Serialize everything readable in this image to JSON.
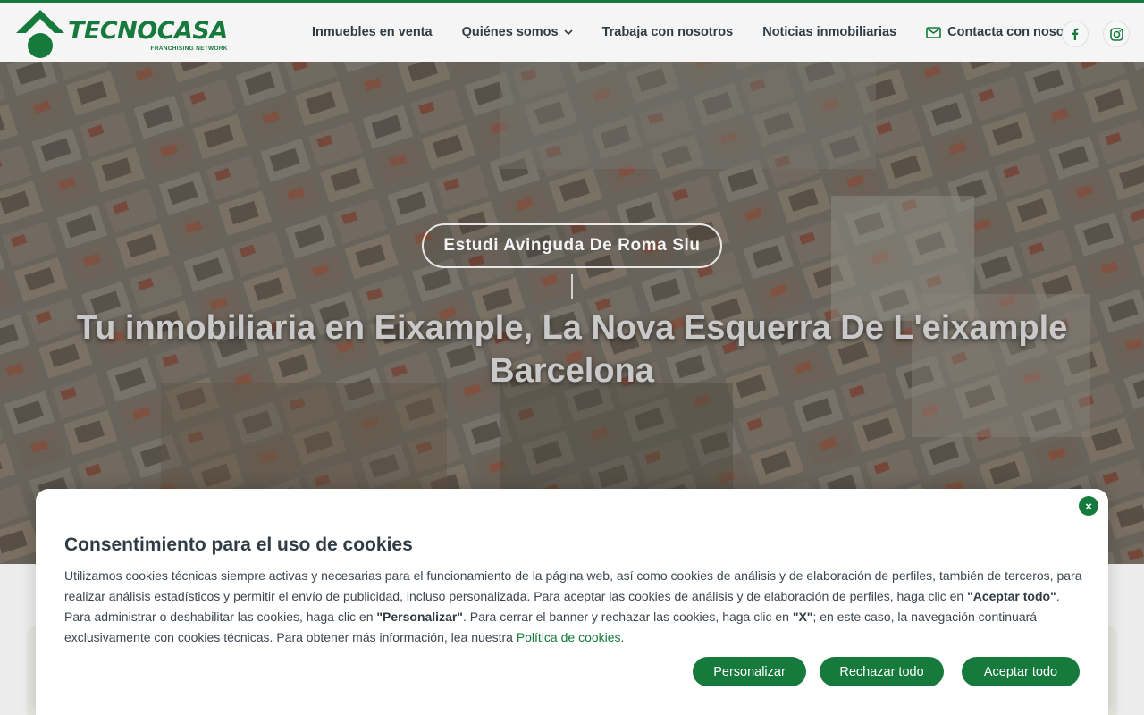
{
  "header": {
    "logo": {
      "word": "TECNOCASA",
      "subtitle": "FRANCHISING NETWORK"
    },
    "nav": [
      {
        "label": "Inmuebles en venta"
      },
      {
        "label": "Quiénes somos"
      },
      {
        "label": "Trabaja con nosotros"
      },
      {
        "label": "Noticias inmobiliarias"
      },
      {
        "label": "Contacta con nosotros"
      }
    ],
    "social": [
      "facebook-icon",
      "instagram-icon"
    ]
  },
  "hero": {
    "agency": "Estudi Avinguda De Roma Slu",
    "title_line1": "Tu inmobiliaria en Eixample, La Nova Esquerra De L'eixample",
    "title_line2": "Barcelona"
  },
  "cookie": {
    "close": "×",
    "title": "Consentimiento para el uso de cookies",
    "text_1": "Utilizamos cookies técnicas siempre activas y necesarias para el funcionamiento de la página web, así como cookies de análisis y de elaboración de perfiles, también de terceros, para realizar análisis estadísticos y permitir el envío de publicidad, incluso personalizada. Para aceptar las cookies de análisis y de elaboración de perfiles, haga clic en ",
    "bold_1": "\"Aceptar todo\"",
    "text_2": ". Para administrar o deshabilitar las cookies, haga clic en ",
    "bold_2": "\"Personalizar\"",
    "text_3": ". Para cerrar el banner y rechazar las cookies, haga clic en ",
    "bold_3": "\"X\"",
    "text_4": "; en este caso, la navegación continuará exclusivamente con cookies técnicas. Para obtener más información, lea nuestra ",
    "link": "Política de cookies",
    "text_5": ".",
    "buttons": {
      "customize": "Personalizar",
      "reject": "Rechazar todo",
      "accept": "Aceptar todo"
    }
  },
  "colors": {
    "brand": "#157a3c",
    "text": "#2f3b45"
  }
}
